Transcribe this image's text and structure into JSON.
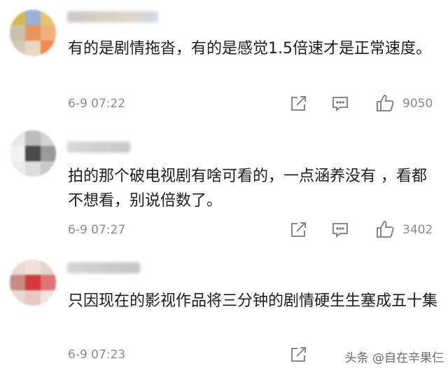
{
  "comments": [
    {
      "text": "有的是剧情拖沓，有的是感觉1.5倍速才是正常速度。",
      "time": "6-9 07:22",
      "likes": "9050",
      "avatar_colors": [
        "#d8b84c",
        "#9ab0d8",
        "#e3c46a",
        "#c9c0a8",
        "#e8945a",
        "#f2b07a",
        "#d4c8b8",
        "#e6d6c2",
        "#f08a52"
      ]
    },
    {
      "text": "拍的那个破电视剧有啥可看的，一点涵养没有 ，看都不想看，别说倍数了。",
      "time": "6-9 07:27",
      "likes": "3402",
      "avatar_colors": [
        "#e6e6e6",
        "#bcbcbc",
        "#d2d2d2",
        "#f2f2f2",
        "#4a4a4a",
        "#9a9a9a",
        "#ececec",
        "#dcdcdc",
        "#c8c8c8"
      ]
    },
    {
      "text": "只因现在的影视作品将三分钟的剧情硬生生塞成五十集",
      "time": "6-9 07:23",
      "likes": "",
      "avatar_colors": [
        "#ead8d0",
        "#f0e0dc",
        "#e6d4cc",
        "#c88a84",
        "#d23a3a",
        "#e07474",
        "#e8d8d2",
        "#e6c8c2",
        "#f0e4e0"
      ]
    }
  ],
  "watermark": "头条 @自在辛果仨"
}
